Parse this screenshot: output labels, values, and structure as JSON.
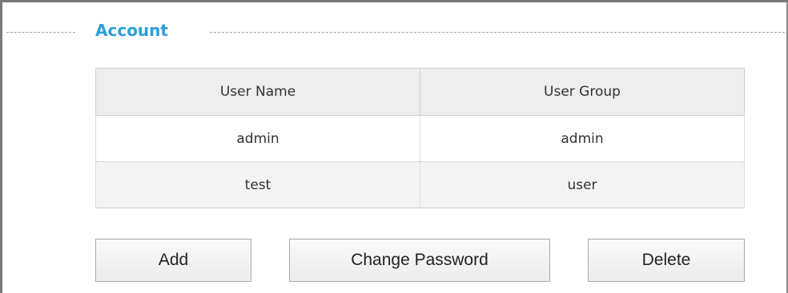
{
  "section": {
    "title": "Account"
  },
  "table": {
    "headers": [
      "User Name",
      "User Group"
    ],
    "rows": [
      [
        "admin",
        "admin"
      ],
      [
        "test",
        "user"
      ]
    ]
  },
  "buttons": {
    "add": "Add",
    "change_password": "Change Password",
    "delete": "Delete"
  },
  "colors": {
    "accent": "#2b9fd8"
  }
}
